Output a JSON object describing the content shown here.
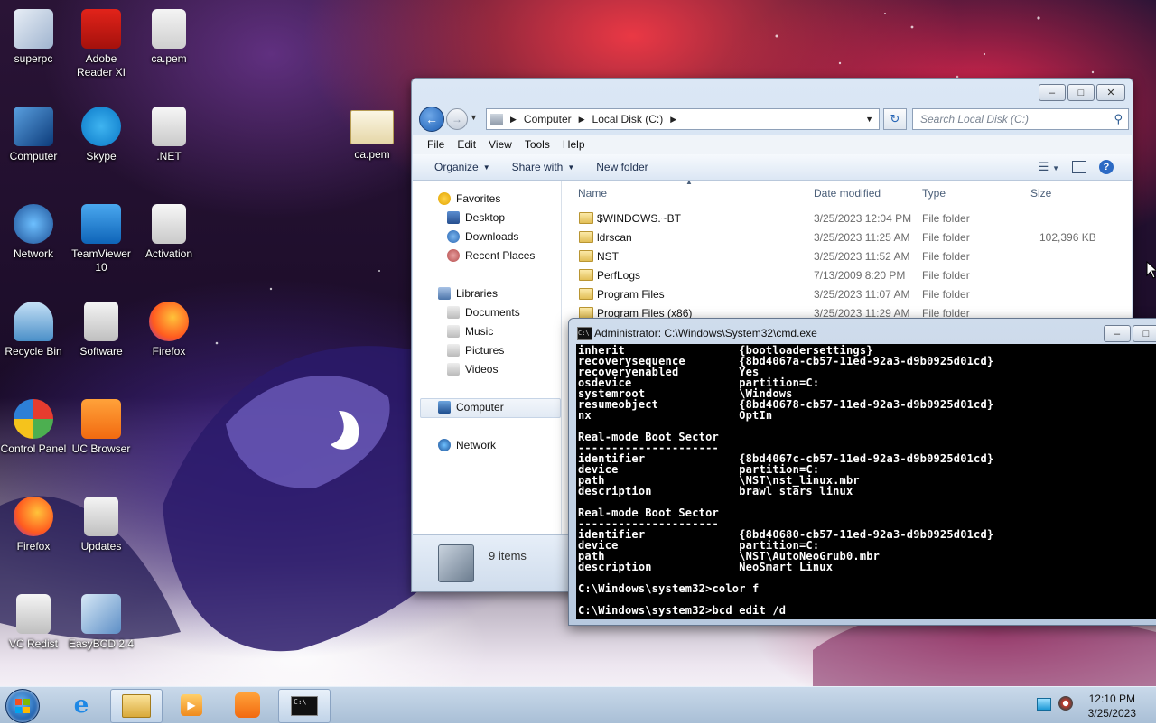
{
  "desktop": {
    "icons": [
      {
        "label": "superpc"
      },
      {
        "label": "Adobe Reader XI"
      },
      {
        "label": "ca.pem"
      },
      {
        "label": "Computer"
      },
      {
        "label": "Skype"
      },
      {
        "label": ".NET"
      },
      {
        "label": "Network"
      },
      {
        "label": "TeamViewer 10"
      },
      {
        "label": "Activation"
      },
      {
        "label": "Recycle Bin"
      },
      {
        "label": "Software"
      },
      {
        "label": "Firefox"
      },
      {
        "label": "Control Panel"
      },
      {
        "label": "UC Browser"
      },
      {
        "label": "Firefox"
      },
      {
        "label": "Updates"
      },
      {
        "label": "VC Redist"
      },
      {
        "label": "EasyBCD 2.4"
      },
      {
        "label": "ca.pem"
      }
    ]
  },
  "explorer": {
    "breadcrumb": [
      "Computer",
      "Local Disk (C:)"
    ],
    "search_placeholder": "Search Local Disk (C:)",
    "menu": [
      "File",
      "Edit",
      "View",
      "Tools",
      "Help"
    ],
    "toolbar": {
      "organize": "Organize",
      "share_with": "Share with",
      "new_folder": "New folder"
    },
    "nav": {
      "favorites": "Favorites",
      "favorites_items": [
        "Desktop",
        "Downloads",
        "Recent Places"
      ],
      "libraries": "Libraries",
      "libraries_items": [
        "Documents",
        "Music",
        "Pictures",
        "Videos"
      ],
      "computer": "Computer",
      "network": "Network"
    },
    "columns": [
      "Name",
      "Date modified",
      "Type",
      "Size"
    ],
    "files": [
      {
        "name": "$WINDOWS.~BT",
        "date": "3/25/2023 12:04 PM",
        "type": "File folder",
        "size": ""
      },
      {
        "name": "ldrscan",
        "date": "3/25/2023 11:25 AM",
        "type": "File folder",
        "size": "102,396 KB"
      },
      {
        "name": "NST",
        "date": "3/25/2023 11:52 AM",
        "type": "File folder",
        "size": ""
      },
      {
        "name": "PerfLogs",
        "date": "7/13/2009 8:20 PM",
        "type": "File folder",
        "size": ""
      },
      {
        "name": "Program Files",
        "date": "3/25/2023 11:07 AM",
        "type": "File folder",
        "size": ""
      },
      {
        "name": "Program Files (x86)",
        "date": "3/25/2023 11:29 AM",
        "type": "File folder",
        "size": ""
      }
    ],
    "status": "9 items"
  },
  "cmd": {
    "title": "Administrator: C:\\Windows\\System32\\cmd.exe",
    "icon_text": "C:\\",
    "lines": [
      "inherit                 {bootloadersettings}",
      "recoverysequence        {8bd4067a-cb57-11ed-92a3-d9b0925d01cd}",
      "recoveryenabled         Yes",
      "osdevice                partition=C:",
      "systemroot              \\Windows",
      "resumeobject            {8bd40678-cb57-11ed-92a3-d9b0925d01cd}",
      "nx                      OptIn",
      "",
      "Real-mode Boot Sector",
      "---------------------",
      "identifier              {8bd4067c-cb57-11ed-92a3-d9b0925d01cd}",
      "device                  partition=C:",
      "path                    \\NST\\nst_linux.mbr",
      "description             brawl stars linux",
      "",
      "Real-mode Boot Sector",
      "---------------------",
      "identifier              {8bd40680-cb57-11ed-92a3-d9b0925d01cd}",
      "device                  partition=C:",
      "path                    \\NST\\AutoNeoGrub0.mbr",
      "description             NeoSmart Linux",
      "",
      "C:\\Windows\\system32>color f",
      "",
      "C:\\Windows\\system32>bcd edit /d"
    ]
  },
  "taskbar": {
    "time": "12:10 PM",
    "date": "3/25/2023",
    "buttons": [
      "internet-explorer",
      "windows-explorer",
      "media-player",
      "uc-browser",
      "command-prompt"
    ]
  },
  "colors": {
    "accent": "#1c5fb5",
    "console_bg": "#000000",
    "console_fg": "#ffffff"
  }
}
